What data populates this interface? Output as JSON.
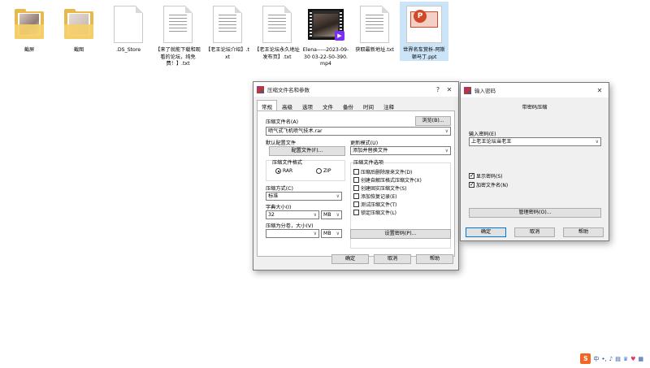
{
  "desktop": {
    "files": [
      {
        "label": "截屏",
        "type": "folder"
      },
      {
        "label": "截图",
        "type": "folder"
      },
      {
        "label": ".DS_Store",
        "type": "file"
      },
      {
        "label": "【来了就能下载和观看的论坛，纯免费！】.txt",
        "type": "txt"
      },
      {
        "label": "【老王论坛介绍】.txt",
        "type": "txt"
      },
      {
        "label": "【老王论坛永久地址发布页】.txt",
        "type": "txt"
      },
      {
        "label": "Elena-----2023-09-30 03-22-50-390.mp4",
        "type": "video"
      },
      {
        "label": "获取最新地址.txt",
        "type": "txt"
      },
      {
        "label": "世界名车赏析-阿斯顿马丁.ppt",
        "type": "ppt"
      }
    ]
  },
  "archive_dialog": {
    "title": "压缩文件名和参数",
    "help_glyph": "?",
    "close_glyph": "✕",
    "tabs": [
      "常规",
      "高级",
      "选项",
      "文件",
      "备份",
      "时间",
      "注释"
    ],
    "archive_name_label": "压缩文件名(A)",
    "browse_button": "浏览(B)...",
    "archive_name_value": "喷气式飞机喷气技术.rar",
    "default_profile_label": "默认配置文件",
    "profiles_button": "配置文件(F)...",
    "update_mode_label": "更新模式(U)",
    "update_mode_value": "添加并替换文件",
    "format_group_label": "压缩文件格式",
    "format_rar": "RAR",
    "format_zip": "ZIP",
    "options_group_label": "压缩文件选项",
    "options": [
      {
        "label": "压缩后删除原来文件(D)",
        "checked": false
      },
      {
        "label": "创建自解压格式压缩文件(X)",
        "checked": false
      },
      {
        "label": "创建固实压缩文件(S)",
        "checked": false
      },
      {
        "label": "添加恢复记录(E)",
        "checked": false
      },
      {
        "label": "测试压缩文件(T)",
        "checked": false
      },
      {
        "label": "锁定压缩文件(L)",
        "checked": false
      }
    ],
    "method_label": "压缩方式(C)",
    "method_value": "标准",
    "dict_label": "字典大小(I)",
    "dict_value": "32",
    "dict_unit": "MB",
    "split_label": "压缩为分卷，大小(V)",
    "split_value": "",
    "split_unit": "MB",
    "set_password_button": "设置密码(P)...",
    "ok_button": "确定",
    "cancel_button": "取消",
    "help_button": "帮助"
  },
  "password_dialog": {
    "title": "输入密码",
    "close_glyph": "✕",
    "subtitle": "带密码压缩",
    "enter_password_label": "输入密码(E)",
    "password_value": "上老王论坛当老王",
    "show_password_label": "显示密码(S)",
    "show_password_checked": true,
    "encrypt_names_label": "加密文件名(N)",
    "encrypt_names_checked": true,
    "organize_button": "管理密码(O)...",
    "ok_button": "确定",
    "cancel_button": "取消",
    "help_button": "帮助"
  },
  "tray": {
    "ime_logo": "S",
    "ime_mode": "中",
    "icons": [
      "punctuation-icon",
      "microphone-icon",
      "keyboard-icon",
      "skin-icon",
      "toolbox-icon",
      "grid-icon"
    ],
    "brand_color": "#f26522"
  }
}
